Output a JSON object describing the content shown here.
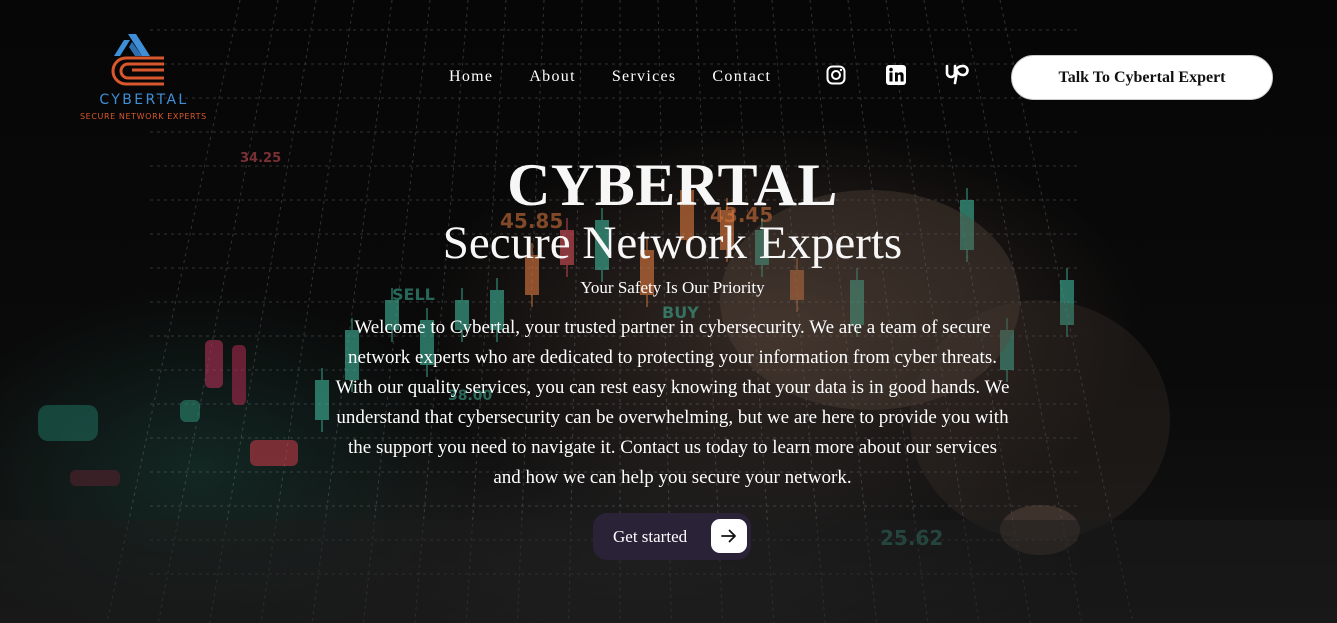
{
  "brand": {
    "name": "CYBERTAL",
    "tagline": "SECURE NETWORK EXPERTS",
    "colors": {
      "blue": "#3f8fd8",
      "orange": "#d9572c"
    }
  },
  "nav": {
    "items": [
      {
        "label": "Home"
      },
      {
        "label": "About"
      },
      {
        "label": "Services"
      },
      {
        "label": "Contact"
      }
    ],
    "social": [
      {
        "icon": "instagram-icon"
      },
      {
        "icon": "linkedin-icon"
      },
      {
        "icon": "upwork-icon"
      }
    ],
    "cta_label": "Talk To Cybertal Expert"
  },
  "hero": {
    "title": "CYBERTAL",
    "subtitle": "Secure Network Experts",
    "tagline": "Your Safety Is Our Priority",
    "body": "Welcome to Cybertal, your trusted partner in cybersecurity. We are a team of secure network experts who are dedicated to protecting your information from cyber threats. With our quality services, you can rest easy knowing that your data is in good hands. We understand that cybersecurity can be overwhelming, but we are here to provide you with the support you need to navigate it. Contact us today to learn more about our services and how we can help you secure your network.",
    "button_label": "Get started"
  },
  "background": {
    "labels": [
      "45.85",
      "43.45",
      "SELL",
      "BUY",
      "25.62",
      "38.00",
      "34.25"
    ],
    "colors": {
      "green": "#3fb59a",
      "red": "#d8505a",
      "orange": "#e07a40"
    }
  }
}
